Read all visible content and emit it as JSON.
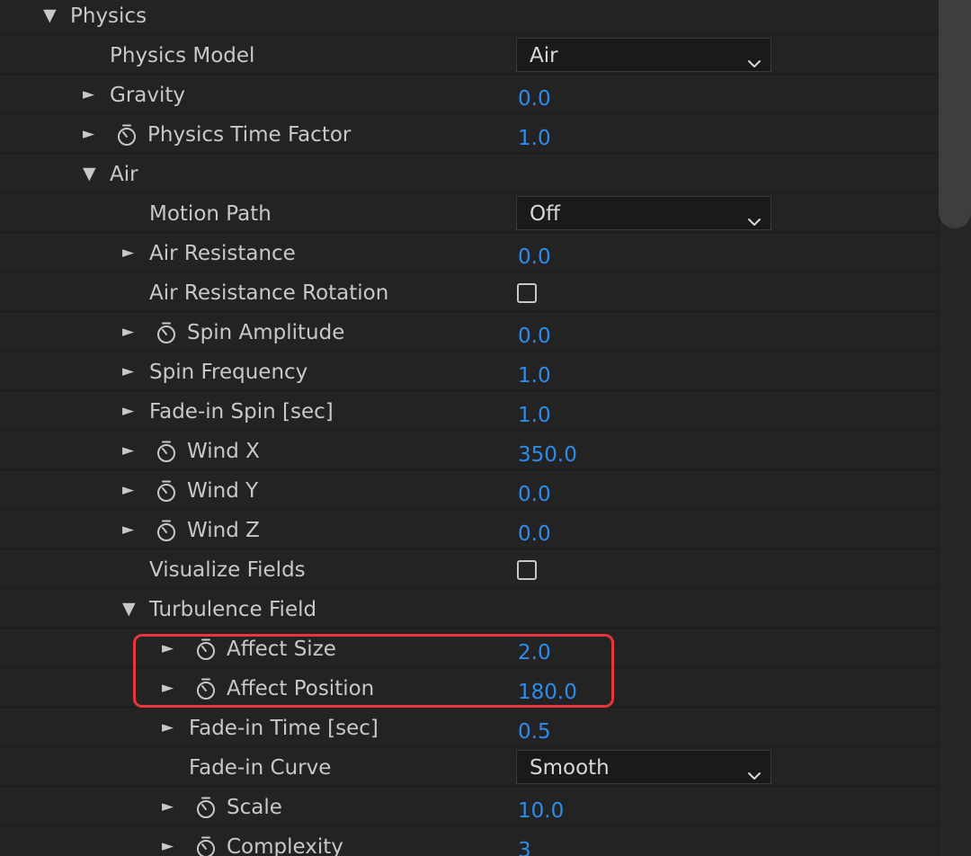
{
  "panel": {
    "rows": [
      {
        "label": "Physics",
        "twirl": "open",
        "depth": 0,
        "stopwatch": false,
        "control": "none"
      },
      {
        "label": "Physics Model",
        "twirl": "none",
        "depth": 1,
        "stopwatch": false,
        "control": "dropdown",
        "value": "Air"
      },
      {
        "label": "Gravity",
        "twirl": "closed",
        "depth": 1,
        "stopwatch": false,
        "control": "number",
        "value": "0.0"
      },
      {
        "label": "Physics Time Factor",
        "twirl": "closed",
        "depth": 1,
        "stopwatch": true,
        "control": "number",
        "value": "1.0"
      },
      {
        "label": "Air",
        "twirl": "open",
        "depth": 1,
        "stopwatch": false,
        "control": "none"
      },
      {
        "label": "Motion Path",
        "twirl": "none",
        "depth": 2,
        "stopwatch": false,
        "control": "dropdown",
        "value": "Off"
      },
      {
        "label": "Air Resistance",
        "twirl": "closed",
        "depth": 2,
        "stopwatch": false,
        "control": "number",
        "value": "0.0"
      },
      {
        "label": "Air Resistance Rotation",
        "twirl": "none",
        "depth": 2,
        "stopwatch": false,
        "control": "checkbox",
        "checked": false
      },
      {
        "label": "Spin Amplitude",
        "twirl": "closed",
        "depth": 2,
        "stopwatch": true,
        "control": "number",
        "value": "0.0"
      },
      {
        "label": "Spin Frequency",
        "twirl": "closed",
        "depth": 2,
        "stopwatch": false,
        "control": "number",
        "value": "1.0"
      },
      {
        "label": "Fade-in Spin [sec]",
        "twirl": "closed",
        "depth": 2,
        "stopwatch": false,
        "control": "number",
        "value": "1.0"
      },
      {
        "label": "Wind X",
        "twirl": "closed",
        "depth": 2,
        "stopwatch": true,
        "control": "number",
        "value": "350.0"
      },
      {
        "label": "Wind Y",
        "twirl": "closed",
        "depth": 2,
        "stopwatch": true,
        "control": "number",
        "value": "0.0"
      },
      {
        "label": "Wind Z",
        "twirl": "closed",
        "depth": 2,
        "stopwatch": true,
        "control": "number",
        "value": "0.0"
      },
      {
        "label": "Visualize Fields",
        "twirl": "none",
        "depth": 2,
        "stopwatch": false,
        "control": "checkbox",
        "checked": false
      },
      {
        "label": "Turbulence Field",
        "twirl": "open",
        "depth": 2,
        "stopwatch": false,
        "control": "none"
      },
      {
        "label": "Affect Size",
        "twirl": "closed",
        "depth": 3,
        "stopwatch": true,
        "control": "number",
        "value": "2.0"
      },
      {
        "label": "Affect Position",
        "twirl": "closed",
        "depth": 3,
        "stopwatch": true,
        "control": "number",
        "value": "180.0"
      },
      {
        "label": "Fade-in Time [sec]",
        "twirl": "closed",
        "depth": 3,
        "stopwatch": false,
        "control": "number",
        "value": "0.5"
      },
      {
        "label": "Fade-in Curve",
        "twirl": "none",
        "depth": 3,
        "stopwatch": false,
        "control": "dropdown",
        "value": "Smooth"
      },
      {
        "label": "Scale",
        "twirl": "closed",
        "depth": 3,
        "stopwatch": true,
        "control": "number",
        "value": "10.0"
      },
      {
        "label": "Complexity",
        "twirl": "closed",
        "depth": 3,
        "stopwatch": true,
        "control": "number",
        "value": "3"
      }
    ]
  },
  "colors": {
    "background": "#232323",
    "label_text": "#c8c8c8",
    "value_blue": "#2d8ceb",
    "highlight_red": "#e8343d"
  },
  "icons": {
    "open_twirl": "triangle-down-icon",
    "closed_twirl": "triangle-right-icon",
    "keyframe": "stopwatch-icon",
    "dropdown": "chevron-down-icon"
  }
}
